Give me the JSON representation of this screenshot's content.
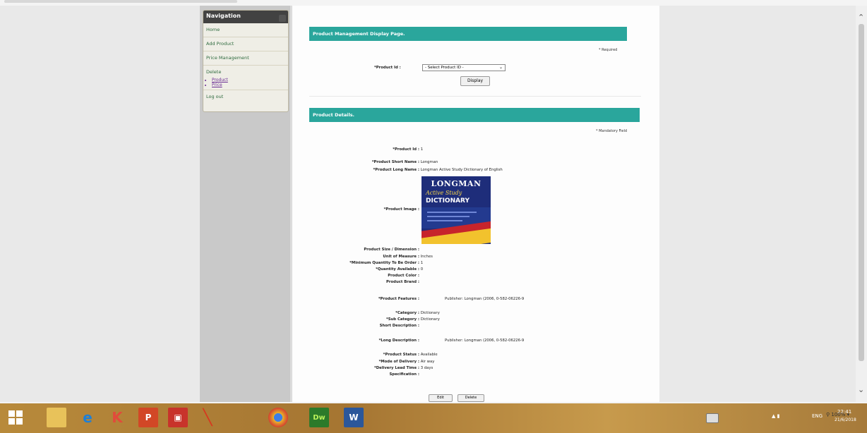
{
  "sidebar": {
    "title": "Navigation",
    "items": [
      {
        "label": "Home"
      },
      {
        "label": "Add Product"
      },
      {
        "label": "Price Management"
      },
      {
        "label": "Delete"
      }
    ],
    "sub_items": [
      {
        "label": "Product"
      },
      {
        "label": "Price"
      }
    ],
    "logout": "Log out"
  },
  "display_panel": {
    "header": "Product Management Display Page.",
    "required_note": "* Required",
    "product_id_label": "*Product Id :",
    "select_value": "- Select Product ID -",
    "display_button": "Display"
  },
  "details_panel": {
    "header": "Product Details.",
    "mandatory_note": "* Mandatory Field",
    "fields": [
      {
        "label": "*Product Id :",
        "value": "1"
      },
      {
        "label": "*Product Short Name :",
        "value": "Longman"
      },
      {
        "label": "*Product Long Name :",
        "value": "Longman Active Study Dictionary of English"
      }
    ],
    "image_label": "*Product Image :",
    "book_cover": {
      "line1": "LONGMAN",
      "line2": "Active Study",
      "line3": "DICTIONARY"
    },
    "fields2": [
      {
        "label": "Product Size / Dimension :",
        "value": ""
      },
      {
        "label": "Unit of Measure :",
        "value": "Inches"
      },
      {
        "label": "*Minimum Quantity To Be Order :",
        "value": "1"
      },
      {
        "label": "*Quantity Available :",
        "value": "0"
      },
      {
        "label": "Product Color :",
        "value": ""
      },
      {
        "label": "Product Brand :",
        "value": ""
      }
    ],
    "features_label": "*Product Features :",
    "features_value": "Publisher: Longman (2006, 0-582-06226-9",
    "fields3": [
      {
        "label": "*Category :",
        "value": "Dictionary"
      },
      {
        "label": "*Sub Category :",
        "value": "Dictionary"
      },
      {
        "label": "Short Description :",
        "value": ""
      }
    ],
    "long_desc_label": "*Long Description :",
    "long_desc_value": "Publisher: Longman (2006, 0-582-06226-9",
    "fields4": [
      {
        "label": "*Product Status :",
        "value": "Available"
      },
      {
        "label": "*Mode of Delivery :",
        "value": "Air way"
      },
      {
        "label": "*Delivery Lead Time :",
        "value": "3 days"
      },
      {
        "label": "Specification :",
        "value": ""
      }
    ],
    "edit_button": "Edit",
    "delete_button": "Delete"
  },
  "browser": {
    "zoom": "100%"
  },
  "taskbar": {
    "apps": [
      "windows-start-icon",
      "file-explorer-icon",
      "internet-explorer-icon",
      "app-icon",
      "powerpoint-icon",
      "app2-icon",
      "app3-icon",
      "chrome-icon",
      "dreamweaver-icon",
      "word-icon"
    ],
    "lang": "ENG",
    "time": "22:41",
    "date": "21/6/2018"
  }
}
